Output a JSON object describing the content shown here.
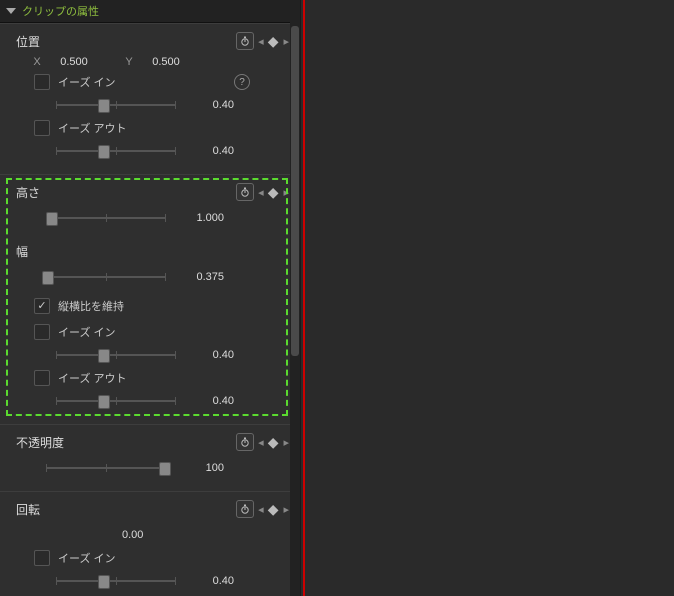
{
  "header": {
    "title": "クリップの属性"
  },
  "sections": {
    "position": {
      "title": "位置",
      "xLabel": "X",
      "xVal": "0.500",
      "yLabel": "Y",
      "yVal": "0.500",
      "easeIn": {
        "label": "イーズ イン",
        "value": "0.40",
        "checked": false
      },
      "easeOut": {
        "label": "イーズ アウト",
        "value": "0.40",
        "checked": false
      }
    },
    "height": {
      "title": "高さ",
      "value": "1.000"
    },
    "width": {
      "title": "幅",
      "value": "0.375"
    },
    "aspect": {
      "label": "縦横比を維持",
      "checked": true
    },
    "scaleEaseIn": {
      "label": "イーズ イン",
      "value": "0.40",
      "checked": false
    },
    "scaleEaseOut": {
      "label": "イーズ アウト",
      "value": "0.40",
      "checked": false
    },
    "opacity": {
      "title": "不透明度",
      "value": "100"
    },
    "rotation": {
      "title": "回転",
      "value": "0.00",
      "easeIn": {
        "label": "イーズ イン",
        "value": "0.40",
        "checked": false
      }
    }
  },
  "help": "?"
}
